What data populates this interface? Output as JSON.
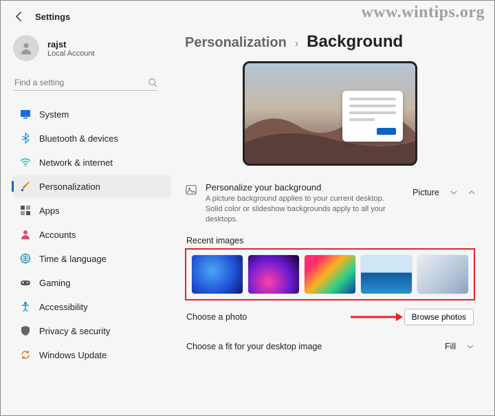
{
  "watermark": "www.wintips.org",
  "header": {
    "title": "Settings"
  },
  "user": {
    "name": "rajst",
    "sub": "Local Account"
  },
  "search": {
    "placeholder": "Find a setting"
  },
  "nav": {
    "items": [
      {
        "label": "System"
      },
      {
        "label": "Bluetooth & devices"
      },
      {
        "label": "Network & internet"
      },
      {
        "label": "Personalization"
      },
      {
        "label": "Apps"
      },
      {
        "label": "Accounts"
      },
      {
        "label": "Time & language"
      },
      {
        "label": "Gaming"
      },
      {
        "label": "Accessibility"
      },
      {
        "label": "Privacy & security"
      },
      {
        "label": "Windows Update"
      }
    ]
  },
  "breadcrumb": {
    "parent": "Personalization",
    "sep": "›",
    "current": "Background"
  },
  "personalize": {
    "title": "Personalize your background",
    "desc": "A picture background applies to your current desktop. Solid color or slideshow backgrounds apply to all your desktops.",
    "select_value": "Picture"
  },
  "recent": {
    "label": "Recent images"
  },
  "choose_photo": {
    "label": "Choose a photo",
    "button": "Browse photos"
  },
  "fit": {
    "label": "Choose a fit for your desktop image",
    "value": "Fill"
  }
}
